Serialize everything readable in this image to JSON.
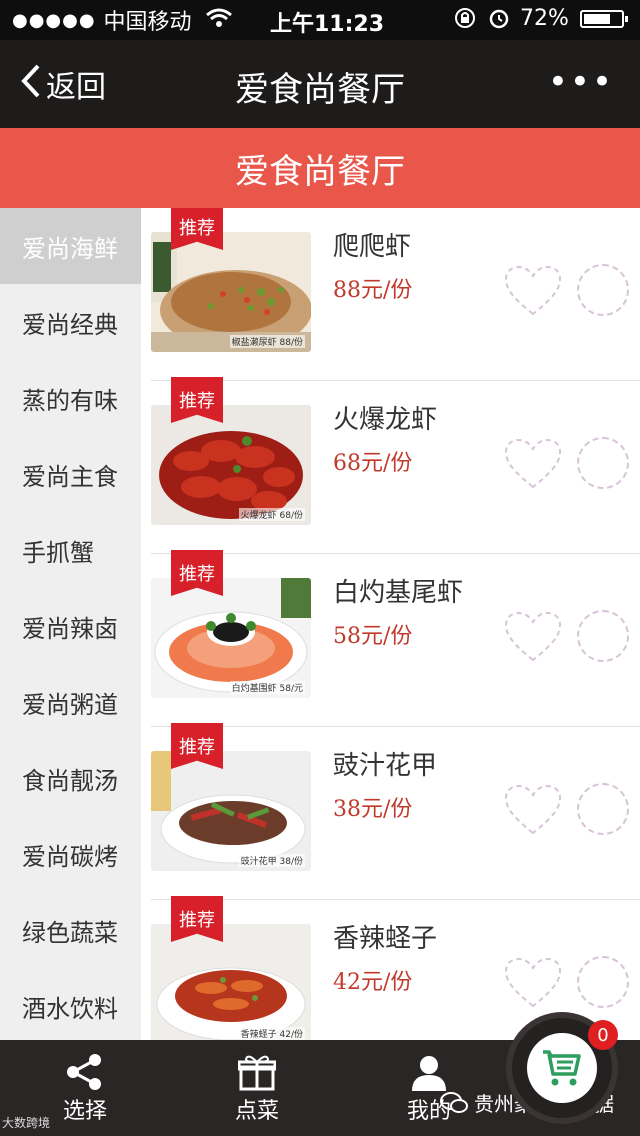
{
  "status_bar": {
    "signal": "●●●●●",
    "carrier": "中国移动",
    "time": "上午11:23",
    "battery": "72%",
    "battery_level": 0.72
  },
  "nav": {
    "back_label": "返回",
    "title": "爱食尚餐厅",
    "more_label": "•••"
  },
  "band_title": "爱食尚餐厅",
  "categories": [
    {
      "label": "爱尚海鲜",
      "active": true
    },
    {
      "label": "爱尚经典"
    },
    {
      "label": "蒸的有味"
    },
    {
      "label": "爱尚主食"
    },
    {
      "label": "手抓蟹"
    },
    {
      "label": "爱尚辣卤"
    },
    {
      "label": "爱尚粥道"
    },
    {
      "label": "食尚靓汤"
    },
    {
      "label": "爱尚碳烤"
    },
    {
      "label": "绿色蔬菜"
    },
    {
      "label": "酒水饮料"
    }
  ],
  "dishes": [
    {
      "badge": "推荐",
      "name": "爬爬虾",
      "price": "88元/份",
      "caption": "椒盐濑尿虾 88/份"
    },
    {
      "badge": "推荐",
      "name": "火爆龙虾",
      "price": "68元/份",
      "caption": "火爆龙虾 68/份"
    },
    {
      "badge": "推荐",
      "name": "白灼基尾虾",
      "price": "58元/份",
      "caption": "白灼基围虾 58/元"
    },
    {
      "badge": "推荐",
      "name": "豉汁花甲",
      "price": "38元/份",
      "caption": "豉汁花甲 38/份"
    },
    {
      "badge": "推荐",
      "name": "香辣蛏子",
      "price": "42元/份",
      "caption": "香辣蛏子 42/份"
    }
  ],
  "tabs": {
    "choose": "选择",
    "order": "点菜",
    "mine": "我的"
  },
  "cart_count": "0",
  "watermark": "贵州聚革大数据",
  "watermark_small": "大数跨境",
  "colors": {
    "accent": "#e9574b",
    "badge_red": "#d8202a",
    "price_red": "#c0392b",
    "nav_dark": "#1e1b1b",
    "tab_dark": "#2b2626",
    "cart_green": "#2e9e5e"
  }
}
